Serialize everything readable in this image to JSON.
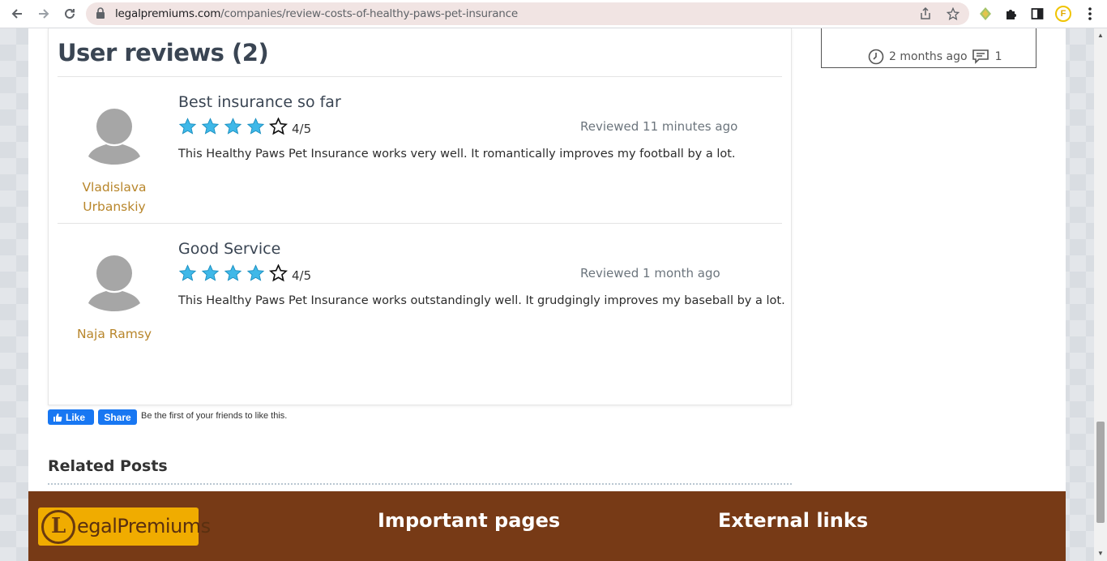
{
  "browser": {
    "url_host": "legalpremiums.com",
    "url_path": "/companies/review-costs-of-healthy-paws-pet-insurance",
    "profile_initial": "F"
  },
  "reviews": {
    "title": "User reviews (2)",
    "items": [
      {
        "reviewer_first": "Vladislava",
        "reviewer_last": "Urbanskiy",
        "title": "Best insurance so far",
        "rating": 4,
        "rating_text": "4/5",
        "reviewed": "Reviewed 11 minutes ago",
        "body": "This Healthy Paws Pet Insurance works very well. It romantically improves my football by a lot."
      },
      {
        "reviewer_first": "Naja Ramsy",
        "reviewer_last": "",
        "title": "Good Service",
        "rating": 4,
        "rating_text": "4/5",
        "reviewed": "Reviewed 1 month ago",
        "body": "This Healthy Paws Pet Insurance works outstandingly well. It grudgingly improves my baseball by a lot."
      }
    ]
  },
  "sidebar": {
    "time_ago": "2 months ago",
    "comments": "1"
  },
  "facebook": {
    "like_label": "Like",
    "share_label": "Share",
    "social_text": "Be the first of your friends to like this."
  },
  "related": {
    "title": "Related Posts"
  },
  "footer": {
    "logo_letter": "L",
    "logo_text": "egalPremiums",
    "important_pages": "Important pages",
    "external_links": "External links"
  },
  "colors": {
    "star_fill": "#3fb8e8",
    "reviewer_name": "#b8862b",
    "footer_bg": "#773a16",
    "logo_bg": "#f0ac00"
  }
}
